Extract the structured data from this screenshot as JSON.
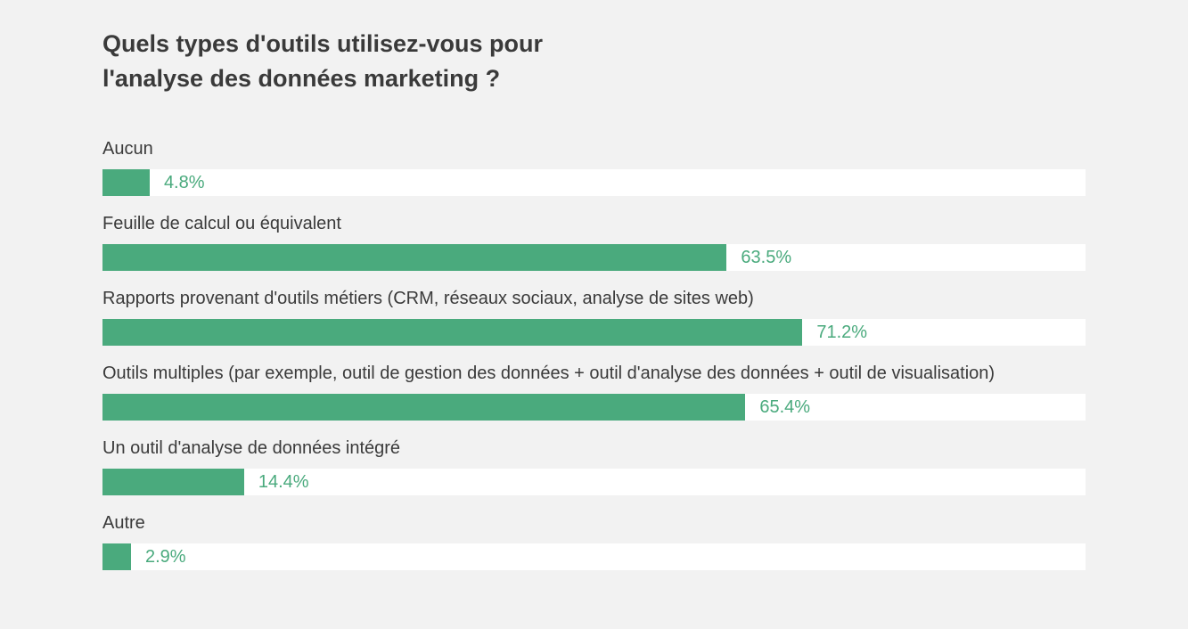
{
  "chart_data": {
    "type": "bar",
    "title": "Quels types d'outils utilisez-vous pour l'analyse des données marketing ?",
    "categories": [
      "Aucun",
      "Feuille de calcul ou équivalent",
      "Rapports provenant d'outils métiers (CRM, réseaux sociaux, analyse de sites web)",
      "Outils multiples (par exemple, outil de gestion des données + outil d'analyse des données + outil de visualisation)",
      "Un outil d'analyse de données intégré",
      "Autre"
    ],
    "values": [
      4.8,
      63.5,
      71.2,
      65.4,
      14.4,
      2.9
    ],
    "value_labels": [
      "4.8%",
      "63.5%",
      "71.2%",
      "65.4%",
      "14.4%",
      "2.9%"
    ],
    "xlabel": "",
    "ylabel": "",
    "xlim": [
      0,
      100
    ],
    "colors": {
      "bar": "#4aaa7d",
      "track": "#ffffff",
      "text": "#3a3a3a"
    }
  }
}
